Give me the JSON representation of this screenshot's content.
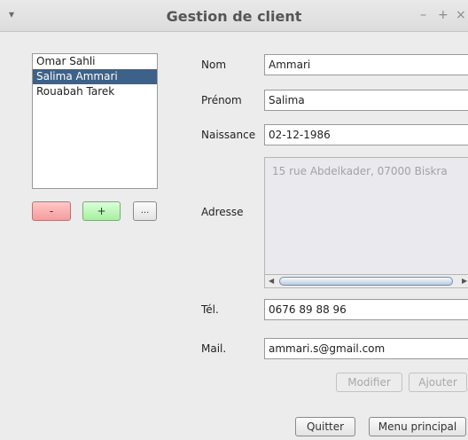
{
  "window": {
    "title": "Gestion de client",
    "menu_glyph": "▾",
    "controls": {
      "minimize": "–",
      "maximize": "+",
      "close": "×"
    }
  },
  "client_list": {
    "items": [
      "Omar Sahli",
      "Salima Ammari",
      "Rouabah Tarek"
    ],
    "selected": "Salima Ammari"
  },
  "list_buttons": {
    "remove": "-",
    "add": "+",
    "more": "..."
  },
  "form": {
    "nom": {
      "label": "Nom",
      "value": "Ammari"
    },
    "prenom": {
      "label": "Prénom",
      "value": "Salima"
    },
    "naissance": {
      "label": "Naissance",
      "value": "02-12-1986"
    },
    "adresse": {
      "label": "Adresse",
      "value": "15 rue Abdelkader, 07000 Biskra"
    },
    "tel": {
      "label": "Tél.",
      "value": "0676 89 88 96"
    },
    "mail": {
      "label": "Mail.",
      "value": "ammari.s@gmail.com"
    }
  },
  "actions": {
    "modifier": "Modifier",
    "ajouter": "Ajouter"
  },
  "footer": {
    "quitter": "Quitter",
    "menu_principal": "Menu principal"
  }
}
